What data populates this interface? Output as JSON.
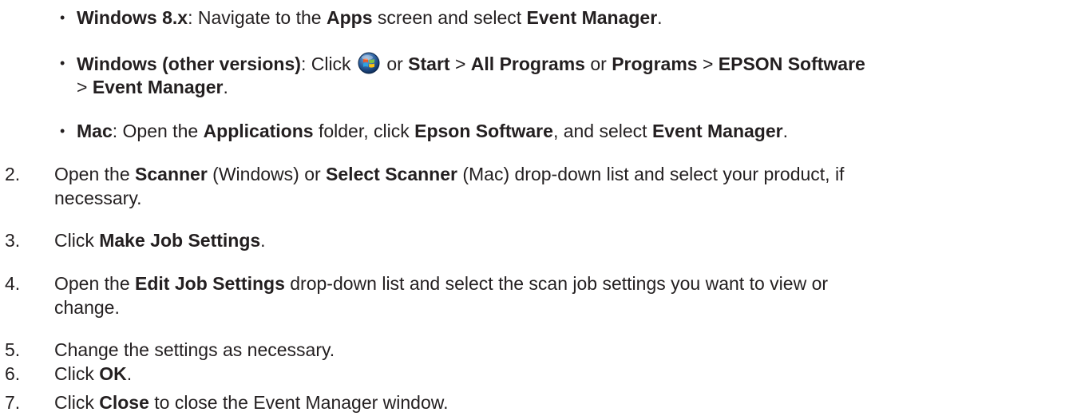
{
  "bullets": [
    {
      "label": "Windows 8.x",
      "sep": ": ",
      "t1": "Navigate to the ",
      "b1": "Apps",
      "t2": " screen and select ",
      "b2": "Event Manager",
      "t3": "."
    },
    {
      "label": "Windows (other versions)",
      "sep": ": Click ",
      "icon": "windows-start-orb-icon",
      "t_or": " or ",
      "b_start": "Start",
      "gt1": " > ",
      "b_allprog": "All Programs",
      "t_or2": " or ",
      "b_prog": "Programs",
      "gt2": " > ",
      "b_epson": "EPSON Software",
      "line2_gt": "> ",
      "line2_b": "Event Manager",
      "line2_end": "."
    },
    {
      "label": "Mac",
      "sep": ": Open the ",
      "b1": "Applications",
      "t1": " folder, click ",
      "b2": "Epson Software",
      "t2": ", and select ",
      "b3": "Event Manager",
      "t3": "."
    }
  ],
  "steps": [
    {
      "num": "2.",
      "t1": "Open the ",
      "b1": "Scanner",
      "t2": " (Windows) or ",
      "b2": "Select Scanner",
      "t3": " (Mac) drop-down list and select your product, if",
      "line2": "necessary."
    },
    {
      "num": "3.",
      "t1": "Click ",
      "b1": "Make Job Settings",
      "t2": "."
    },
    {
      "num": "4.",
      "t1": "Open the ",
      "b1": "Edit Job Settings",
      "t2": " drop-down list and select the scan job settings you want to view or",
      "line2": "change."
    },
    {
      "num": "5.",
      "t1": "Change the settings as necessary."
    },
    {
      "num": "6.",
      "t1": "Click ",
      "b1": "OK",
      "t2": "."
    },
    {
      "num": "7.",
      "t1": "Click ",
      "b1": "Close",
      "t2": " to close the Event Manager window."
    }
  ],
  "bullet_glyph": "•"
}
